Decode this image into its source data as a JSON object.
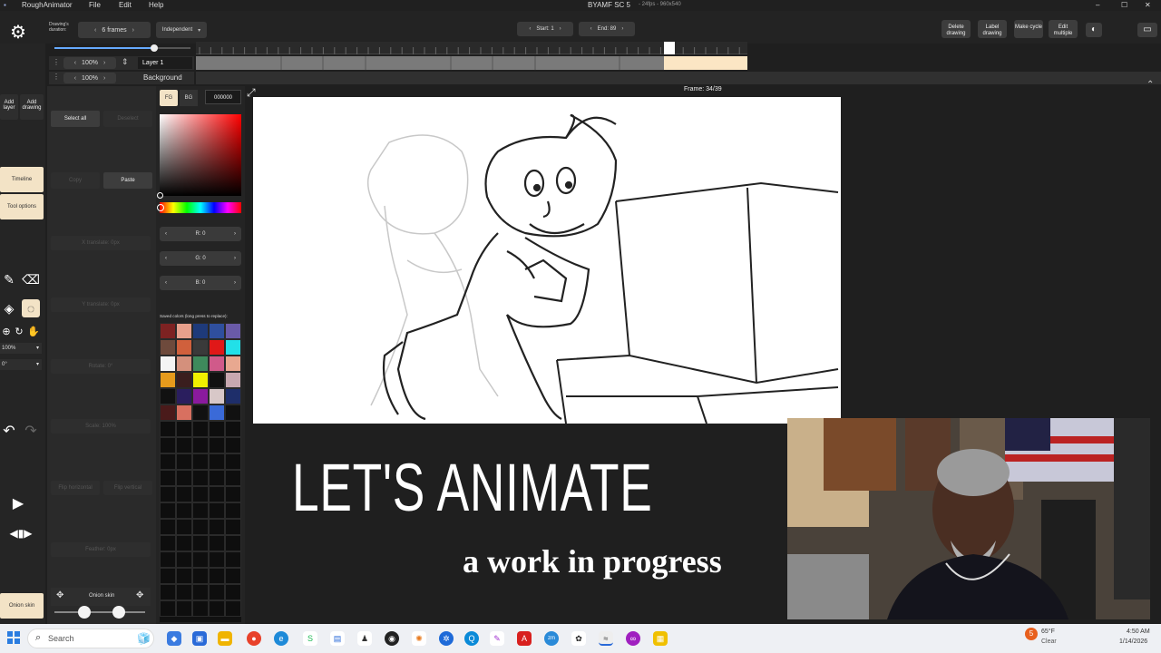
{
  "window": {
    "app_name": "RoughAnimator",
    "title": "BYAMF SC 5",
    "title_suffix": "- 24fps - 960x540",
    "menu": [
      "File",
      "Edit",
      "Help"
    ],
    "minimize": "–",
    "maximize": "☐",
    "close": "✕"
  },
  "toolbar": {
    "drawing_duration_label": "Drawing's duration:",
    "duration_value": "6 frames",
    "mode_value": "Independent",
    "start_label": "Start: 1",
    "end_label": "End: 89",
    "frame_label": "Frame: 34/39",
    "buttons": [
      "Delete drawing",
      "Label drawing",
      "Make cycle",
      "Edit multiple"
    ]
  },
  "layers": [
    {
      "opacity": "100%",
      "name": "Layer 1"
    },
    {
      "opacity": "100%",
      "name": "Background"
    }
  ],
  "left_panel": {
    "add_layer": "Add layer",
    "add_drawing": "Add drawing",
    "timeline": "Timeline",
    "tool_options": "Tool options",
    "zoom": "100%",
    "rotation": "0°",
    "onion_skin": "Onion skin"
  },
  "options_panel": {
    "select_all": "Select all",
    "deselect": "Deselect",
    "copy": "Copy",
    "paste": "Paste",
    "x_translate": "X translate: 0px",
    "y_translate": "Y translate: 0px",
    "rotate": "Rotate: 0°",
    "scale": "Scale: 100%",
    "flip_h": "Flip horizontal",
    "flip_v": "Flip vertical",
    "feather": "Feather: 0px",
    "onion_skin": "Onion skin"
  },
  "color_panel": {
    "fg": "FG",
    "bg": "BG",
    "hex": "000000",
    "r": "R: 0",
    "g": "G: 0",
    "b": "B: 0",
    "saved_label": "Saved colors (long press to replace):",
    "swatches": [
      "#7d2222",
      "#e8a08c",
      "#1e3a7a",
      "#2f4f9e",
      "#6a5aa8",
      "#6e4a3c",
      "#d0603c",
      "#3a3a3a",
      "#e01818",
      "#22e0e8",
      "#f4f4f4",
      "#d4907c",
      "#3e8a5c",
      "#d05a8a",
      "#e8a890",
      "#e69b1c",
      "#3a1e1e",
      "#f0f000",
      "#111111",
      "#c8a8b0",
      "#111111",
      "#2a1e5e",
      "#8a1a9e",
      "#d8c8c8",
      "#1e2e6a",
      "#4a1a1a",
      "#d87060",
      "#111111",
      "#3a6ad8",
      "#111111"
    ]
  },
  "overlay": {
    "heading": "LET'S ANIMATE",
    "subheading": "a work in progress"
  },
  "taskbar": {
    "search": "Search",
    "weather_temp": "65°F",
    "weather_cond": "Clear",
    "time": "4:50 AM",
    "date": "1/14/2026",
    "badge": "5"
  },
  "colors": {
    "accent": "#f3e3c6",
    "panel": "#2a2a2a",
    "canvas": "#ffffff",
    "frame_highlight": "#fbe6c4"
  }
}
